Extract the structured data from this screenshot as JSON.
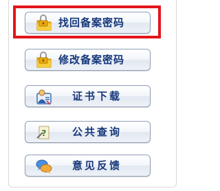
{
  "menu": {
    "items": [
      {
        "label": "找回备案密码",
        "icon": "lock-folder-icon"
      },
      {
        "label": "修改备案密码",
        "icon": "lock-folder-icon"
      },
      {
        "label": "证书下载",
        "icon": "certificate-user-icon"
      },
      {
        "label": "公共查询",
        "icon": "question-note-icon"
      },
      {
        "label": "意见反馈",
        "icon": "chat-bubbles-icon"
      }
    ],
    "highlight_color": "#e3151b",
    "label_color": "#16387a"
  }
}
